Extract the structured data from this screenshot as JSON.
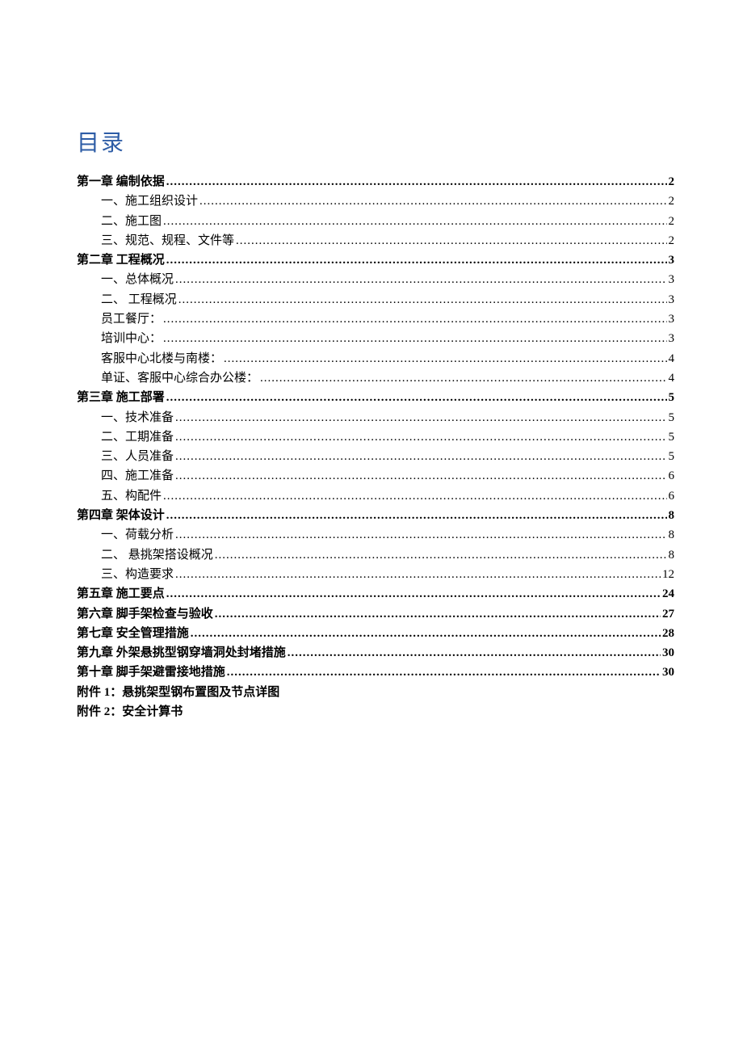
{
  "title": "目录",
  "entries": [
    {
      "level": 1,
      "text": "第一章  编制依据",
      "page": "2"
    },
    {
      "level": 2,
      "text": "一、施工组织设计",
      "page": "2"
    },
    {
      "level": 2,
      "text": "二、施工图",
      "page": "2"
    },
    {
      "level": 2,
      "text": "三、规范、规程、文件等",
      "page": "2"
    },
    {
      "level": 1,
      "text": "第二章  工程概况",
      "page": "3"
    },
    {
      "level": 2,
      "text": "一、总体概况",
      "page": "3"
    },
    {
      "level": 2,
      "text": "二、  工程概况",
      "page": "3"
    },
    {
      "level": 2,
      "text": "员工餐厅：",
      "page": "3"
    },
    {
      "level": 2,
      "text": "培训中心：",
      "page": "3"
    },
    {
      "level": 2,
      "text": "客服中心北楼与南楼：",
      "page": "4"
    },
    {
      "level": 2,
      "text": "单证、客服中心综合办公楼：",
      "page": "4"
    },
    {
      "level": 1,
      "text": "第三章  施工部署",
      "page": "5"
    },
    {
      "level": 2,
      "text": "一、技术准备",
      "page": "5"
    },
    {
      "level": 2,
      "text": "二、工期准备",
      "page": "5"
    },
    {
      "level": 2,
      "text": "三、人员准备",
      "page": "5"
    },
    {
      "level": 2,
      "text": "四、施工准备",
      "page": "6"
    },
    {
      "level": 2,
      "text": "五、构配件",
      "page": "6"
    },
    {
      "level": 1,
      "text": "第四章  架体设计",
      "page": "8"
    },
    {
      "level": 2,
      "text": "一、荷载分析",
      "page": "8"
    },
    {
      "level": 2,
      "text": "二、  悬挑架搭设概况",
      "page": "8"
    },
    {
      "level": 2,
      "text": "三、构造要求",
      "page": "12"
    },
    {
      "level": 1,
      "text": "第五章  施工要点",
      "page": "24"
    },
    {
      "level": 1,
      "text": "第六章  脚手架检查与验收",
      "page": "27"
    },
    {
      "level": 1,
      "text": "第七章  安全管理措施",
      "page": "28"
    },
    {
      "level": 1,
      "text": "第九章  外架悬挑型钢穿墙洞处封堵措施",
      "page": "30"
    },
    {
      "level": 1,
      "text": "第十章  脚手架避雷接地措施",
      "page": "30"
    }
  ],
  "appendices": [
    "附件 1：悬挑架型钢布置图及节点详图",
    "附件 2：安全计算书"
  ]
}
